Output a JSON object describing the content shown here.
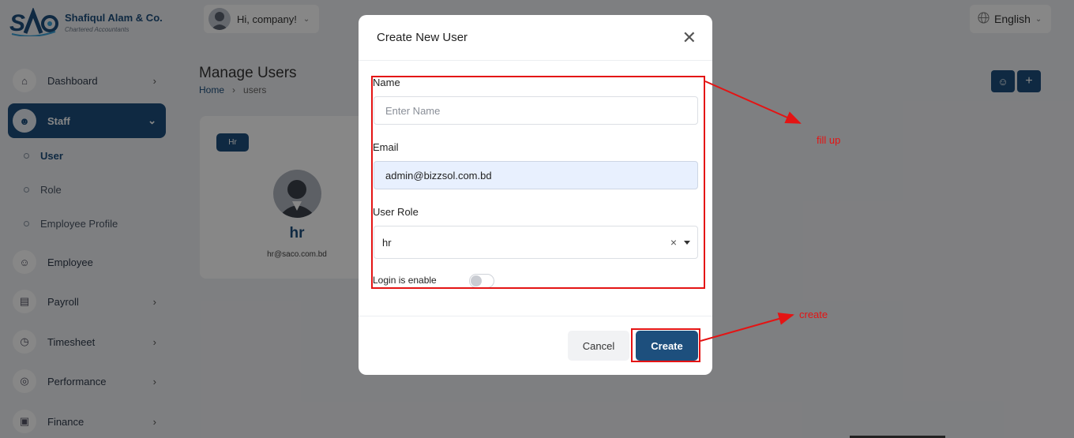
{
  "header": {
    "company_name": "Shafiqul Alam & Co.",
    "company_sub": "Chartered Accountants",
    "greeting": "Hi, company!",
    "language": "English"
  },
  "sidebar": {
    "items": [
      {
        "label": "Dashboard"
      },
      {
        "label": "Staff"
      },
      {
        "label": "Employee"
      },
      {
        "label": "Payroll"
      },
      {
        "label": "Timesheet"
      },
      {
        "label": "Performance"
      },
      {
        "label": "Finance"
      }
    ],
    "staff_sub": [
      {
        "label": "User"
      },
      {
        "label": "Role"
      },
      {
        "label": "Employee Profile"
      }
    ]
  },
  "main": {
    "title": "Manage Users",
    "breadcrumb": {
      "home": "Home",
      "current": "users"
    },
    "card": {
      "badge": "Hr",
      "name": "hr",
      "email": "hr@saco.com.bd"
    }
  },
  "modal": {
    "title": "Create New User",
    "name_label": "Name",
    "name_placeholder": "Enter Name",
    "email_label": "Email",
    "email_value": "admin@bizzsol.com.bd",
    "role_label": "User Role",
    "role_value": "hr",
    "login_label": "Login is enable",
    "login_enabled": false,
    "cancel_label": "Cancel",
    "create_label": "Create"
  },
  "annotations": {
    "fill_note": "fill up",
    "create_note": "create",
    "color": "#e41414"
  },
  "colors": {
    "brand": "#1d4f7d"
  }
}
